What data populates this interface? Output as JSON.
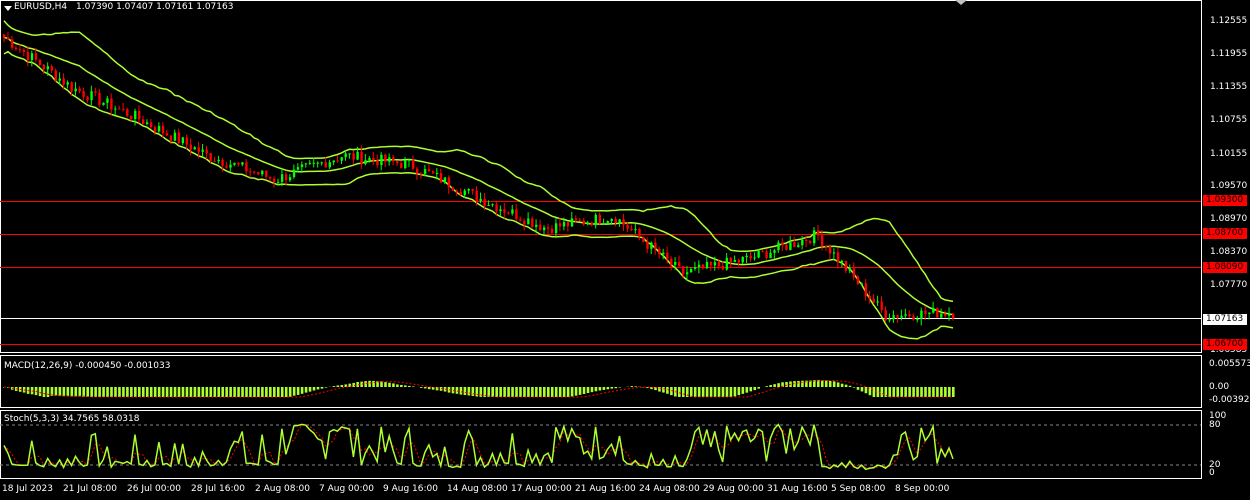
{
  "header": {
    "symbol_label": "EURUSD,H4",
    "ohlc": "1.07390 1.07407 1.07161 1.07163"
  },
  "price_axis": {
    "ticks": [
      "1.12555",
      "1.11955",
      "1.11355",
      "1.10755",
      "1.10155",
      "1.09570",
      "1.08970",
      "1.08370",
      "1.07770",
      "1.06585"
    ],
    "levels": [
      {
        "label": "1.09300",
        "price": 1.093,
        "kind": "resistance",
        "color": "#ff0000"
      },
      {
        "label": "1.08700",
        "price": 1.087,
        "kind": "resistance",
        "color": "#ff0000"
      },
      {
        "label": "1.08090",
        "price": 1.0809,
        "kind": "resistance",
        "color": "#ff0000"
      },
      {
        "label": "1.07163",
        "price": 1.07163,
        "kind": "current",
        "color": "#ffffff"
      },
      {
        "label": "1.06700",
        "price": 1.067,
        "kind": "support",
        "color": "#ff0000"
      }
    ]
  },
  "time_axis": {
    "labels": [
      "18 Jul 2023",
      "21 Jul 08:00",
      "26 Jul 00:00",
      "28 Jul 16:00",
      "2 Aug 08:00",
      "7 Aug 00:00",
      "9 Aug 16:00",
      "14 Aug 08:00",
      "17 Aug 00:00",
      "21 Aug 16:00",
      "24 Aug 08:00",
      "29 Aug 00:00",
      "31 Aug 16:00",
      "5 Sep 08:00",
      "8 Sep 00:00"
    ]
  },
  "macd": {
    "label": "MACD(12,26,9) -0.000450 -0.001033",
    "ticks": [
      "0.005573",
      "0.00",
      "-0.00392"
    ]
  },
  "stoch": {
    "label": "Stoch(5,3,3) 34.7565 58.0318",
    "ticks": [
      "100",
      "80",
      "20",
      "0"
    ]
  },
  "colors": {
    "background": "#000000",
    "bull_candle": "#00ff00",
    "bear_candle": "#ff0000",
    "bands": "#adff2f",
    "macd_hist": "#adff2f",
    "signal": "#ff0000",
    "level_line": "#ff0000",
    "current_line": "#ffffff"
  },
  "chart_data": {
    "type": "candlestick",
    "symbol": "EURUSD",
    "timeframe": "H4",
    "indicators": [
      "Bollinger Bands",
      "MACD(12,26,9)",
      "Stoch(5,3,3)"
    ],
    "close_path": [
      [
        "18 Jul 2023",
        1.1226
      ],
      [
        "21 Jul 08:00",
        1.1135
      ],
      [
        "26 Jul 00:00",
        1.1078
      ],
      [
        "28 Jul 16:00",
        1.1012
      ],
      [
        "2 Aug 08:00",
        1.0968
      ],
      [
        "7 Aug 00:00",
        1.1012
      ],
      [
        "9 Aug 16:00",
        1.0995
      ],
      [
        "14 Aug 08:00",
        1.0935
      ],
      [
        "17 Aug 00:00",
        1.088
      ],
      [
        "21 Aug 16:00",
        1.0902
      ],
      [
        "24 Aug 08:00",
        1.0798
      ],
      [
        "29 Aug 00:00",
        1.0825
      ],
      [
        "31 Aug 16:00",
        1.0868
      ],
      [
        "5 Sep 08:00",
        1.0722
      ],
      [
        "8 Sep 00:00",
        1.0728
      ]
    ]
  }
}
